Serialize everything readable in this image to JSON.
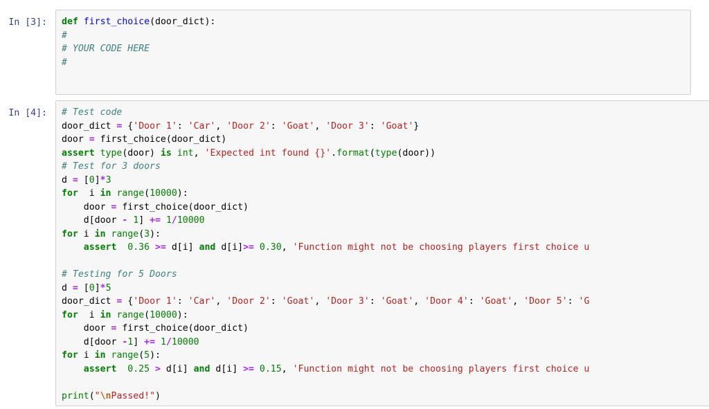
{
  "theme": {
    "page_background": "#ffffff",
    "cell_background": "#f7f7f7",
    "cell_border": "#cfcfcf",
    "prompt_color": "#303f9f",
    "keyword_color": "#008000",
    "function_color": "#0000ff",
    "comment_color": "#408080",
    "string_color": "#ba2121",
    "number_color": "#008000",
    "operator_color": "#aa22ff",
    "escape_color": "#bb6622"
  },
  "cells": [
    {
      "prompt": "In [3]:",
      "execution_count": 3,
      "cell_type": "code",
      "source": "def first_choice(door_dict):\n#\n# YOUR CODE HERE\n#",
      "lines": [
        [
          {
            "t": "def",
            "c": "t-k"
          },
          {
            "t": " ",
            "c": "t-p"
          },
          {
            "t": "first_choice",
            "c": "t-nf"
          },
          {
            "t": "(door_dict):",
            "c": "t-p"
          }
        ],
        [
          {
            "t": "#",
            "c": "t-c"
          }
        ],
        [
          {
            "t": "# YOUR CODE HERE",
            "c": "t-c"
          }
        ],
        [
          {
            "t": "#",
            "c": "t-c"
          }
        ]
      ]
    },
    {
      "prompt": "In [4]:",
      "execution_count": 4,
      "cell_type": "code",
      "source": "# Test code\ndoor_dict = {'Door 1': 'Car', 'Door 2': 'Goat', 'Door 3': 'Goat'}\ndoor = first_choice(door_dict)\nassert type(door) is int, 'Expected int found {}'.format(type(door))\n# Test for 3 doors\nd = [0]*3\nfor  i in range(10000):\n    door = first_choice(door_dict)\n    d[door - 1] += 1/10000\nfor i in range(3):\n    assert  0.36 >= d[i] and d[i]>= 0.30, 'Function might not be choosing players first choice u\n\n# Testing for 5 Doors\nd = [0]*5\ndoor_dict = {'Door 1': 'Car', 'Door 2': 'Goat', 'Door 3': 'Goat', 'Door 4': 'Goat', 'Door 5': 'G\nfor  i in range(10000):\n    door = first_choice(door_dict)\n    d[door -1] += 1/10000\nfor i in range(5):\n    assert  0.25 > d[i] and d[i] >= 0.15, 'Function might not be choosing players first choice u\n\nprint(\"\\nPassed!\")",
      "lines": [
        [
          {
            "t": "# Test code",
            "c": "t-c"
          }
        ],
        [
          {
            "t": "door_dict ",
            "c": "t-p"
          },
          {
            "t": "=",
            "c": "t-o"
          },
          {
            "t": " {",
            "c": "t-p"
          },
          {
            "t": "'Door 1'",
            "c": "t-s"
          },
          {
            "t": ": ",
            "c": "t-p"
          },
          {
            "t": "'Car'",
            "c": "t-s"
          },
          {
            "t": ", ",
            "c": "t-p"
          },
          {
            "t": "'Door 2'",
            "c": "t-s"
          },
          {
            "t": ": ",
            "c": "t-p"
          },
          {
            "t": "'Goat'",
            "c": "t-s"
          },
          {
            "t": ", ",
            "c": "t-p"
          },
          {
            "t": "'Door 3'",
            "c": "t-s"
          },
          {
            "t": ": ",
            "c": "t-p"
          },
          {
            "t": "'Goat'",
            "c": "t-s"
          },
          {
            "t": "}",
            "c": "t-p"
          }
        ],
        [
          {
            "t": "door ",
            "c": "t-p"
          },
          {
            "t": "=",
            "c": "t-o"
          },
          {
            "t": " first_choice(door_dict)",
            "c": "t-p"
          }
        ],
        [
          {
            "t": "assert",
            "c": "t-k"
          },
          {
            "t": " ",
            "c": "t-p"
          },
          {
            "t": "type",
            "c": "t-nb"
          },
          {
            "t": "(door) ",
            "c": "t-p"
          },
          {
            "t": "is",
            "c": "t-k"
          },
          {
            "t": " ",
            "c": "t-p"
          },
          {
            "t": "int",
            "c": "t-nb"
          },
          {
            "t": ", ",
            "c": "t-p"
          },
          {
            "t": "'Expected int found {}'",
            "c": "t-s"
          },
          {
            "t": ".",
            "c": "t-p"
          },
          {
            "t": "format",
            "c": "t-nb"
          },
          {
            "t": "(",
            "c": "t-p"
          },
          {
            "t": "type",
            "c": "t-nb"
          },
          {
            "t": "(door))",
            "c": "t-p"
          }
        ],
        [
          {
            "t": "# Test for 3 doors",
            "c": "t-c"
          }
        ],
        [
          {
            "t": "d ",
            "c": "t-p"
          },
          {
            "t": "=",
            "c": "t-o"
          },
          {
            "t": " [",
            "c": "t-p"
          },
          {
            "t": "0",
            "c": "t-m"
          },
          {
            "t": "]",
            "c": "t-p"
          },
          {
            "t": "*",
            "c": "t-o"
          },
          {
            "t": "3",
            "c": "t-m"
          }
        ],
        [
          {
            "t": "for",
            "c": "t-k"
          },
          {
            "t": "  i ",
            "c": "t-p"
          },
          {
            "t": "in",
            "c": "t-k"
          },
          {
            "t": " ",
            "c": "t-p"
          },
          {
            "t": "range",
            "c": "t-nb"
          },
          {
            "t": "(",
            "c": "t-p"
          },
          {
            "t": "10000",
            "c": "t-m"
          },
          {
            "t": "):",
            "c": "t-p"
          }
        ],
        [
          {
            "t": "    door ",
            "c": "t-p"
          },
          {
            "t": "=",
            "c": "t-o"
          },
          {
            "t": " first_choice(door_dict)",
            "c": "t-p"
          }
        ],
        [
          {
            "t": "    d[door ",
            "c": "t-p"
          },
          {
            "t": "-",
            "c": "t-o"
          },
          {
            "t": " ",
            "c": "t-p"
          },
          {
            "t": "1",
            "c": "t-m"
          },
          {
            "t": "] ",
            "c": "t-p"
          },
          {
            "t": "+=",
            "c": "t-o"
          },
          {
            "t": " ",
            "c": "t-p"
          },
          {
            "t": "1",
            "c": "t-m"
          },
          {
            "t": "/",
            "c": "t-o"
          },
          {
            "t": "10000",
            "c": "t-m"
          }
        ],
        [
          {
            "t": "for",
            "c": "t-k"
          },
          {
            "t": " i ",
            "c": "t-p"
          },
          {
            "t": "in",
            "c": "t-k"
          },
          {
            "t": " ",
            "c": "t-p"
          },
          {
            "t": "range",
            "c": "t-nb"
          },
          {
            "t": "(",
            "c": "t-p"
          },
          {
            "t": "3",
            "c": "t-m"
          },
          {
            "t": "):",
            "c": "t-p"
          }
        ],
        [
          {
            "t": "    ",
            "c": "t-p"
          },
          {
            "t": "assert",
            "c": "t-k"
          },
          {
            "t": "  ",
            "c": "t-p"
          },
          {
            "t": "0.36",
            "c": "t-m"
          },
          {
            "t": " ",
            "c": "t-p"
          },
          {
            "t": ">=",
            "c": "t-ow"
          },
          {
            "t": " d[i] ",
            "c": "t-p"
          },
          {
            "t": "and",
            "c": "t-k"
          },
          {
            "t": " d[i]",
            "c": "t-p"
          },
          {
            "t": ">=",
            "c": "t-ow"
          },
          {
            "t": " ",
            "c": "t-p"
          },
          {
            "t": "0.30",
            "c": "t-m"
          },
          {
            "t": ", ",
            "c": "t-p"
          },
          {
            "t": "'Function might not be choosing players first choice u",
            "c": "t-s"
          }
        ],
        [
          {
            "t": "",
            "c": "t-p"
          }
        ],
        [
          {
            "t": "# Testing for 5 Doors",
            "c": "t-c"
          }
        ],
        [
          {
            "t": "d ",
            "c": "t-p"
          },
          {
            "t": "=",
            "c": "t-o"
          },
          {
            "t": " [",
            "c": "t-p"
          },
          {
            "t": "0",
            "c": "t-m"
          },
          {
            "t": "]",
            "c": "t-p"
          },
          {
            "t": "*",
            "c": "t-o"
          },
          {
            "t": "5",
            "c": "t-m"
          }
        ],
        [
          {
            "t": "door_dict ",
            "c": "t-p"
          },
          {
            "t": "=",
            "c": "t-o"
          },
          {
            "t": " {",
            "c": "t-p"
          },
          {
            "t": "'Door 1'",
            "c": "t-s"
          },
          {
            "t": ": ",
            "c": "t-p"
          },
          {
            "t": "'Car'",
            "c": "t-s"
          },
          {
            "t": ", ",
            "c": "t-p"
          },
          {
            "t": "'Door 2'",
            "c": "t-s"
          },
          {
            "t": ": ",
            "c": "t-p"
          },
          {
            "t": "'Goat'",
            "c": "t-s"
          },
          {
            "t": ", ",
            "c": "t-p"
          },
          {
            "t": "'Door 3'",
            "c": "t-s"
          },
          {
            "t": ": ",
            "c": "t-p"
          },
          {
            "t": "'Goat'",
            "c": "t-s"
          },
          {
            "t": ", ",
            "c": "t-p"
          },
          {
            "t": "'Door 4'",
            "c": "t-s"
          },
          {
            "t": ": ",
            "c": "t-p"
          },
          {
            "t": "'Goat'",
            "c": "t-s"
          },
          {
            "t": ", ",
            "c": "t-p"
          },
          {
            "t": "'Door 5'",
            "c": "t-s"
          },
          {
            "t": ": ",
            "c": "t-p"
          },
          {
            "t": "'G",
            "c": "t-s"
          }
        ],
        [
          {
            "t": "for",
            "c": "t-k"
          },
          {
            "t": "  i ",
            "c": "t-p"
          },
          {
            "t": "in",
            "c": "t-k"
          },
          {
            "t": " ",
            "c": "t-p"
          },
          {
            "t": "range",
            "c": "t-nb"
          },
          {
            "t": "(",
            "c": "t-p"
          },
          {
            "t": "10000",
            "c": "t-m"
          },
          {
            "t": "):",
            "c": "t-p"
          }
        ],
        [
          {
            "t": "    door ",
            "c": "t-p"
          },
          {
            "t": "=",
            "c": "t-o"
          },
          {
            "t": " first_choice(door_dict)",
            "c": "t-p"
          }
        ],
        [
          {
            "t": "    d[door ",
            "c": "t-p"
          },
          {
            "t": "-",
            "c": "t-o"
          },
          {
            "t": "1",
            "c": "t-m"
          },
          {
            "t": "] ",
            "c": "t-p"
          },
          {
            "t": "+=",
            "c": "t-o"
          },
          {
            "t": " ",
            "c": "t-p"
          },
          {
            "t": "1",
            "c": "t-m"
          },
          {
            "t": "/",
            "c": "t-o"
          },
          {
            "t": "10000",
            "c": "t-m"
          }
        ],
        [
          {
            "t": "for",
            "c": "t-k"
          },
          {
            "t": " i ",
            "c": "t-p"
          },
          {
            "t": "in",
            "c": "t-k"
          },
          {
            "t": " ",
            "c": "t-p"
          },
          {
            "t": "range",
            "c": "t-nb"
          },
          {
            "t": "(",
            "c": "t-p"
          },
          {
            "t": "5",
            "c": "t-m"
          },
          {
            "t": "):",
            "c": "t-p"
          }
        ],
        [
          {
            "t": "    ",
            "c": "t-p"
          },
          {
            "t": "assert",
            "c": "t-k"
          },
          {
            "t": "  ",
            "c": "t-p"
          },
          {
            "t": "0.25",
            "c": "t-m"
          },
          {
            "t": " ",
            "c": "t-p"
          },
          {
            "t": ">",
            "c": "t-ow"
          },
          {
            "t": " d[i] ",
            "c": "t-p"
          },
          {
            "t": "and",
            "c": "t-k"
          },
          {
            "t": " d[i] ",
            "c": "t-p"
          },
          {
            "t": ">=",
            "c": "t-ow"
          },
          {
            "t": " ",
            "c": "t-p"
          },
          {
            "t": "0.15",
            "c": "t-m"
          },
          {
            "t": ", ",
            "c": "t-p"
          },
          {
            "t": "'Function might not be choosing players first choice u",
            "c": "t-s"
          }
        ],
        [
          {
            "t": "",
            "c": "t-p"
          }
        ],
        [
          {
            "t": "print",
            "c": "t-nb"
          },
          {
            "t": "(",
            "c": "t-p"
          },
          {
            "t": "\"",
            "c": "t-s"
          },
          {
            "t": "\\n",
            "c": "t-se"
          },
          {
            "t": "Passed!\"",
            "c": "t-s"
          },
          {
            "t": ")",
            "c": "t-p"
          }
        ]
      ]
    }
  ]
}
